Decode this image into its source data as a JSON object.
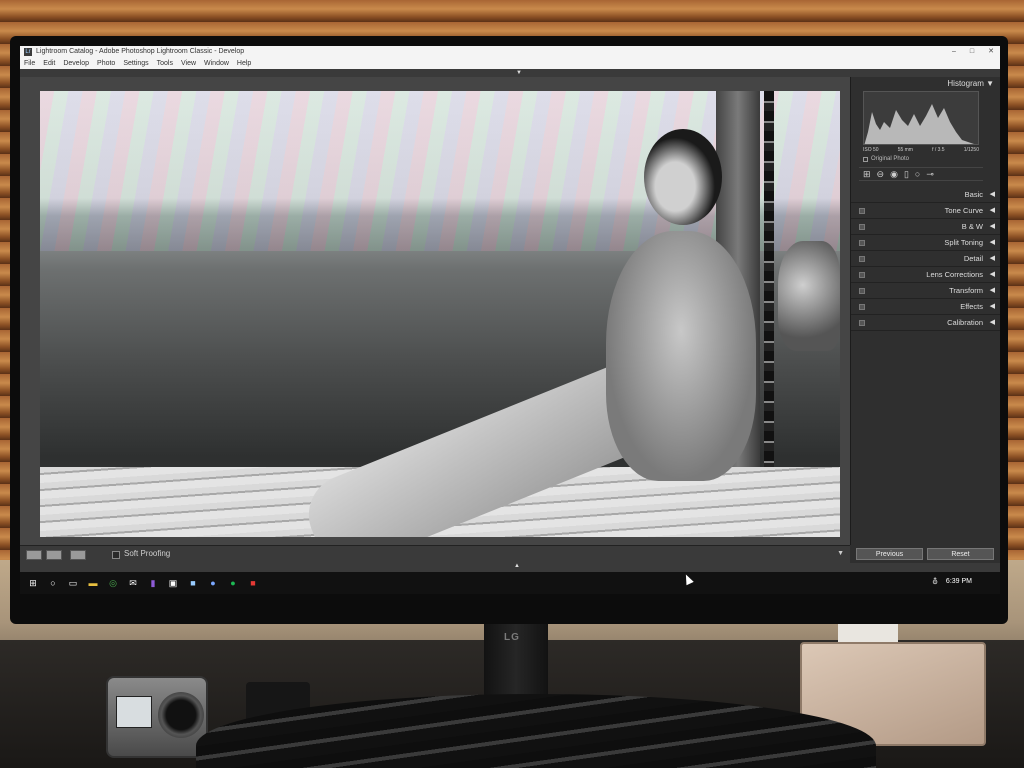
{
  "window": {
    "title": "Lightroom Catalog - Adobe Photoshop Lightroom Classic - Develop",
    "app_icon": "Lr",
    "controls": [
      "–",
      "□",
      "✕"
    ]
  },
  "menu": [
    "File",
    "Edit",
    "Develop",
    "Photo",
    "Settings",
    "Tools",
    "View",
    "Window",
    "Help"
  ],
  "right_panel": {
    "histogram_label": "Histogram",
    "info": {
      "iso": "ISO 50",
      "focal": "55 mm",
      "aperture": "f / 3.5",
      "shutter": "1/1250"
    },
    "original_photo_label": "Original Photo",
    "tool_icons": [
      "crop-icon",
      "spot-removal-icon",
      "red-eye-icon",
      "graduated-filter-icon",
      "radial-filter-icon",
      "brush-icon"
    ],
    "panels": [
      "Basic",
      "Tone Curve",
      "B & W",
      "Split Toning",
      "Detail",
      "Lens Corrections",
      "Transform",
      "Effects",
      "Calibration"
    ],
    "previous_label": "Previous",
    "reset_label": "Reset"
  },
  "toolbar": {
    "soft_proofing_label": "Soft Proofing"
  },
  "taskbar": {
    "clock": "6:39 PM",
    "icons": [
      "windows-start-icon",
      "cortana-icon",
      "task-view-icon",
      "chrome-icon",
      "file-explorer-icon",
      "mail-icon",
      "onenote-icon",
      "photos-icon",
      "lightroom-icon",
      "info-icon",
      "spotify-icon",
      "media-icon"
    ]
  },
  "monitor": {
    "brand": "LG"
  }
}
